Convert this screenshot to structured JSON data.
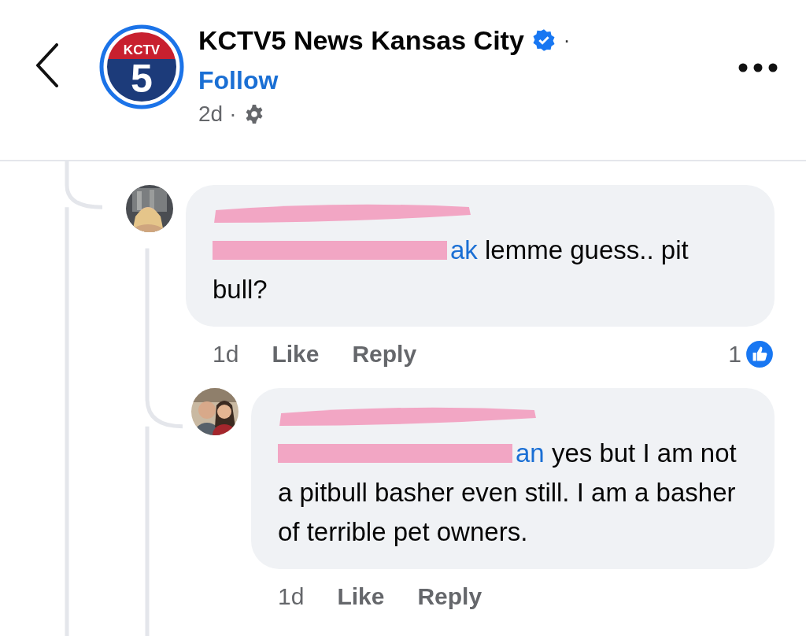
{
  "post_header": {
    "logo_text": "KCTV",
    "logo_number": "5",
    "page_name": "KCTV5 News Kansas City",
    "verified": true,
    "title_separator": "·",
    "follow": "Follow",
    "time": "2d",
    "time_separator": "·"
  },
  "comments": [
    {
      "mention_tail": "ak",
      "text": "lemme guess.. pit bull?",
      "time": "1d",
      "like": "Like",
      "reply": "Reply",
      "reaction_count": "1",
      "children": [
        {
          "mention_tail": "an",
          "text": "yes but I am not a pitbull basher even still. I am a basher of terrible pet owners.",
          "time": "1d",
          "like": "Like",
          "reply": "Reply"
        }
      ]
    }
  ]
}
